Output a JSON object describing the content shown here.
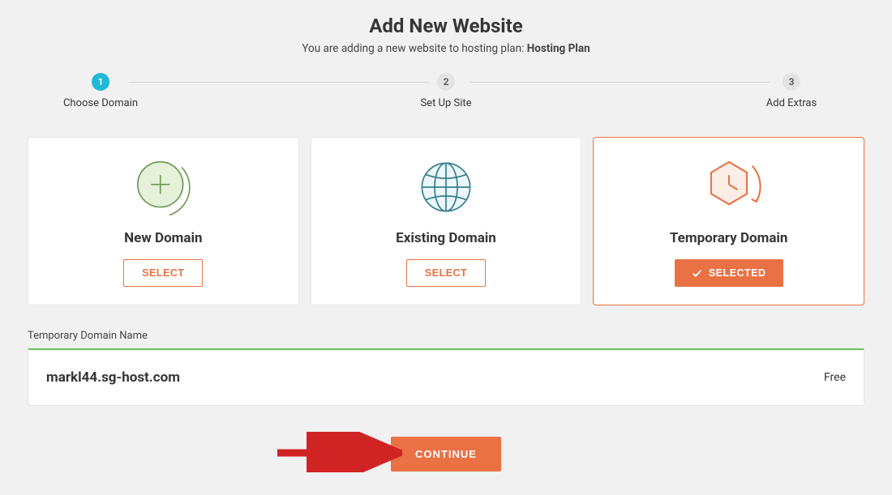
{
  "header": {
    "title": "Add New Website",
    "subtitle_prefix": "You are adding a new website to hosting plan:",
    "plan_name": "Hosting Plan"
  },
  "stepper": {
    "steps": [
      {
        "num": "1",
        "label": "Choose Domain"
      },
      {
        "num": "2",
        "label": "Set Up Site"
      },
      {
        "num": "3",
        "label": "Add Extras"
      }
    ]
  },
  "cards": {
    "new": {
      "title": "New Domain",
      "button": "SELECT"
    },
    "existing": {
      "title": "Existing Domain",
      "button": "SELECT"
    },
    "temp": {
      "title": "Temporary Domain",
      "button": "SELECTED"
    }
  },
  "domain_section": {
    "label": "Temporary Domain Name",
    "domain": "markl44.sg-host.com",
    "price": "Free"
  },
  "footer": {
    "continue": "CONTINUE"
  }
}
